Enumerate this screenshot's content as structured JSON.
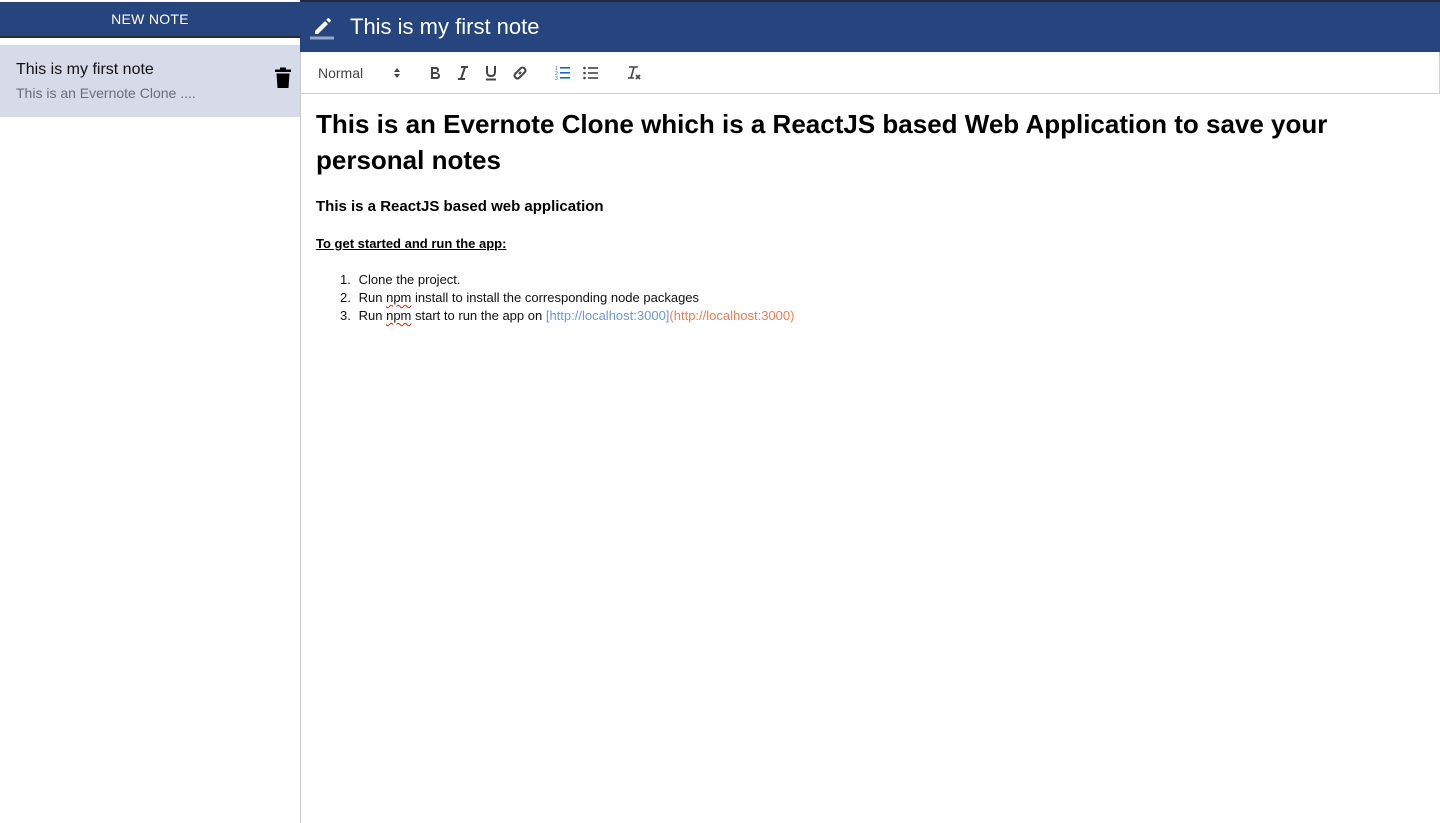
{
  "sidebar": {
    "new_note_label": "NEW NOTE",
    "notes": [
      {
        "title": "This is my first note",
        "preview": "This is an Evernote Clone ...."
      }
    ]
  },
  "header": {
    "note_title": "This is my first note"
  },
  "toolbar": {
    "heading_select": "Normal"
  },
  "editor": {
    "heading": "This is an Evernote Clone which is a ReactJS based Web Application to save your personal notes",
    "subheading": "This is a ReactJS based web application",
    "section_title": "To get started and run the app:",
    "steps": [
      {
        "num": "1.",
        "text": "Clone the project."
      },
      {
        "num": "2.",
        "pre": "Run ",
        "code": "npm",
        "post": " install  to install the corresponding node packages"
      },
      {
        "num": "3.",
        "pre": "Run ",
        "code": "npm",
        "post": " start  to run the app on ",
        "link_text": "[http://localhost:3000]",
        "link_url": "(http://localhost:3000)"
      }
    ]
  },
  "colors": {
    "header_bg": "#26457f",
    "selected_note_bg": "#d6dae9",
    "link_text": "#6f98d8",
    "link_url": "#ec7e58"
  }
}
